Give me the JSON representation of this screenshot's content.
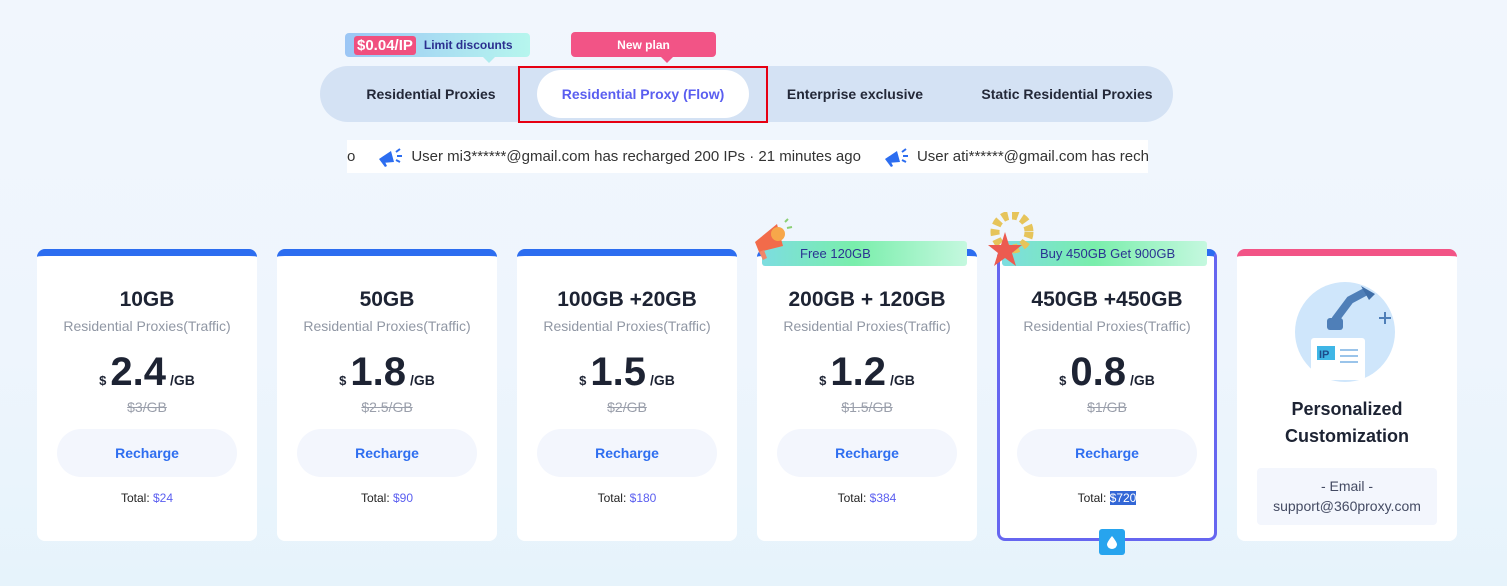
{
  "badges": {
    "discount_price": "$0.04/IP",
    "discount_label": "Limit discounts",
    "new_plan": "New plan"
  },
  "tabs": [
    {
      "label": "Residential Proxies"
    },
    {
      "label": "Residential Proxy (Flow)",
      "active": true
    },
    {
      "label": "Enterprise exclusive"
    },
    {
      "label": "Static Residential Proxies"
    }
  ],
  "ticker": {
    "lead": "o",
    "items": [
      "User mi3******@gmail.com has recharged 200 IPs · 21 minutes ago",
      "User ati******@gmail.com has recha"
    ]
  },
  "plans": [
    {
      "gb": "10GB",
      "sub": "Residential Proxies(Traffic)",
      "currency": "$",
      "price": "2.4",
      "unit": "/GB",
      "old": "$3/GB",
      "button": "Recharge",
      "total_label": "Total:",
      "total": "$24"
    },
    {
      "gb": "50GB",
      "sub": "Residential Proxies(Traffic)",
      "currency": "$",
      "price": "1.8",
      "unit": "/GB",
      "old": "$2.5/GB",
      "button": "Recharge",
      "total_label": "Total:",
      "total": "$90"
    },
    {
      "gb": "100GB +20GB",
      "sub": "Residential Proxies(Traffic)",
      "currency": "$",
      "price": "1.5",
      "unit": "/GB",
      "old": "$2/GB",
      "button": "Recharge",
      "total_label": "Total:",
      "total": "$180"
    },
    {
      "gb": "200GB + 120GB",
      "sub": "Residential Proxies(Traffic)",
      "currency": "$",
      "price": "1.2",
      "unit": "/GB",
      "old": "$1.5/GB",
      "button": "Recharge",
      "total_label": "Total:",
      "total": "$384",
      "promo": "Free 120GB"
    },
    {
      "gb": "450GB +450GB",
      "sub": "Residential Proxies(Traffic)",
      "currency": "$",
      "price": "0.8",
      "unit": "/GB",
      "old": "$1/GB",
      "button": "Recharge",
      "total_label": "Total:",
      "total": "$720",
      "promo": "Buy 450GB Get 900GB"
    }
  ],
  "custom": {
    "title": "Personalized Customization",
    "email_label": "- Email -",
    "email": "support@360proxy.com",
    "ip_label": "IP"
  },
  "colors": {
    "accent": "#5a5ef0",
    "blue": "#2c6df0",
    "pink": "#f25486",
    "highlight": "#e60012"
  }
}
